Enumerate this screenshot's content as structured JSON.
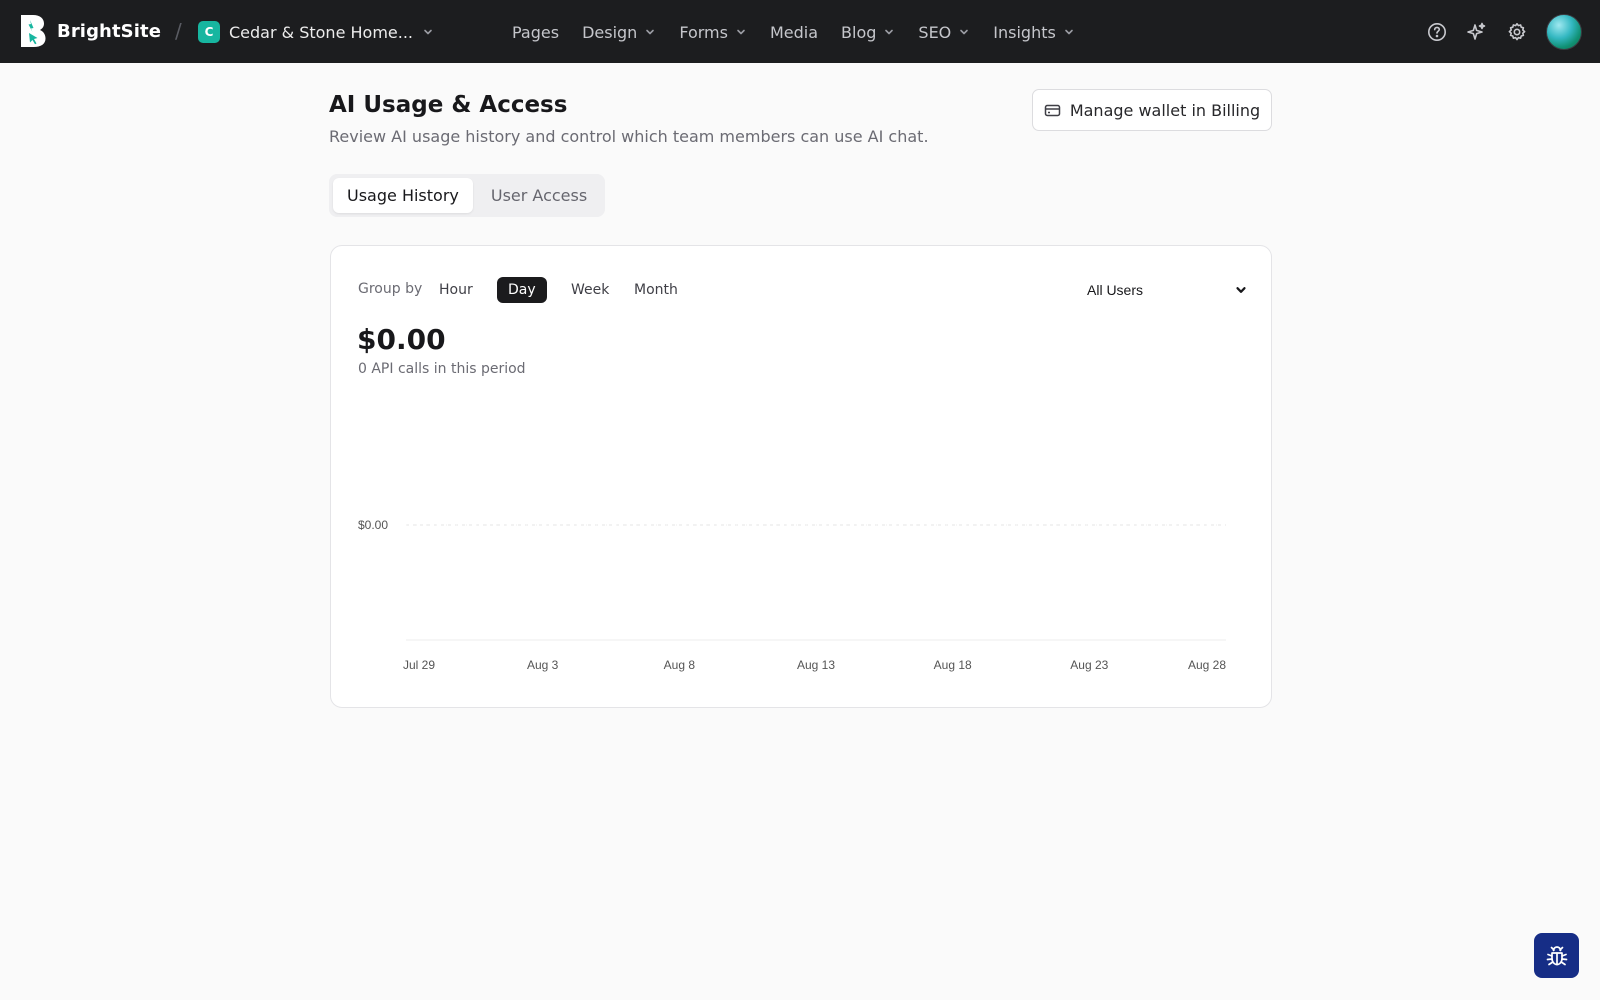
{
  "app": {
    "brand_name": "BrightSite",
    "site_badge": "C",
    "site_name": "Cedar & Stone Home...",
    "nav": [
      {
        "label": "Pages",
        "dropdown": false
      },
      {
        "label": "Design",
        "dropdown": true
      },
      {
        "label": "Forms",
        "dropdown": true
      },
      {
        "label": "Media",
        "dropdown": false
      },
      {
        "label": "Blog",
        "dropdown": true
      },
      {
        "label": "SEO",
        "dropdown": true
      },
      {
        "label": "Insights",
        "dropdown": true
      }
    ],
    "top_icons": [
      "help-icon",
      "sparkles-icon",
      "gear-icon"
    ]
  },
  "header": {
    "title": "AI Usage & Access",
    "subtitle": "Review AI usage history and control which team members can use AI chat.",
    "billing_button": "Manage wallet in Billing"
  },
  "tabs": [
    {
      "label": "Usage History",
      "active": true
    },
    {
      "label": "User Access",
      "active": false
    }
  ],
  "usage": {
    "group_by_label": "Group by",
    "group_options": [
      "Hour",
      "Day",
      "Week",
      "Month"
    ],
    "selected_group": "Day",
    "user_filter": "All Users",
    "total": "$0.00",
    "calls_text": "0 API calls in this period"
  },
  "chart_data": {
    "type": "line",
    "x_ticks": [
      "Jul 29",
      "Aug 3",
      "Aug 8",
      "Aug 13",
      "Aug 18",
      "Aug 23",
      "Aug 28"
    ],
    "y_ticks": [
      "$0.00"
    ],
    "series": [
      {
        "values": [
          0,
          0,
          0,
          0,
          0,
          0,
          0
        ]
      }
    ],
    "grid": true
  },
  "colors": {
    "topbar": "#1c1d1f",
    "accent_teal": "#17b6a0",
    "bug_button": "#162d86",
    "active_segment": "#1b1b1d"
  }
}
